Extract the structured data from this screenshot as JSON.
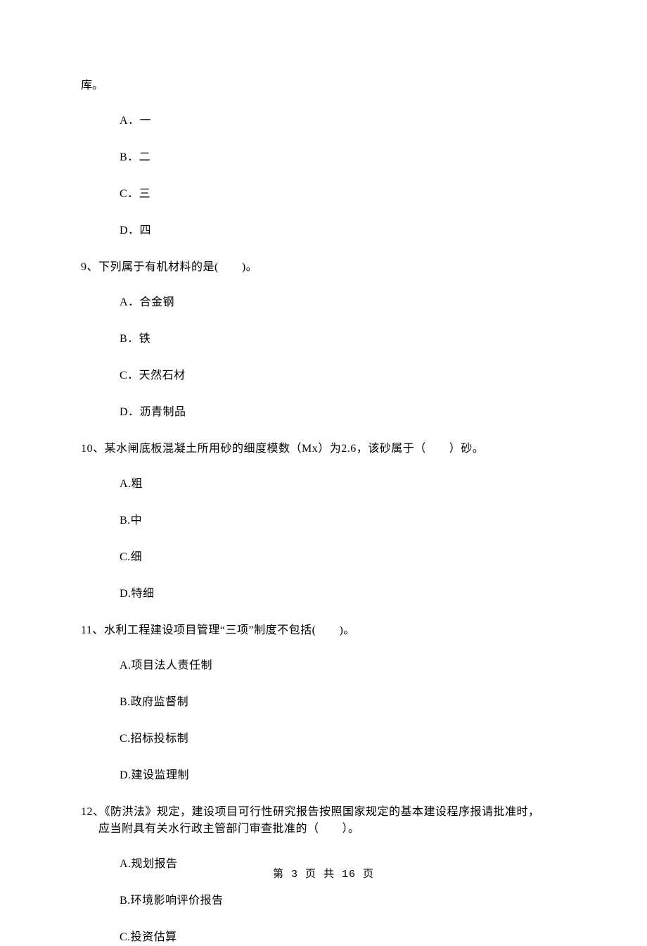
{
  "fragment": "库。",
  "q8_options": {
    "A": "A．一",
    "B": "B．二",
    "C": "C．三",
    "D": "D．四"
  },
  "q9": {
    "stem": "9、下列属于有机材料的是(　　)。",
    "A": "A．合金钢",
    "B": "B．铁",
    "C": "C．天然石材",
    "D": "D．沥青制品"
  },
  "q10": {
    "stem": "10、某水闸底板混凝土所用砂的细度模数（Mx）为2.6，该砂属于（　　）砂。",
    "A": "A.粗",
    "B": "B.中",
    "C": "C.细",
    "D": "D.特细"
  },
  "q11": {
    "stem": "11、水利工程建设项目管理“三项”制度不包括(　　)。",
    "A": "A.项目法人责任制",
    "B": "B.政府监督制",
    "C": "C.招标投标制",
    "D": "D.建设监理制"
  },
  "q12": {
    "stem_line1": "12、《防洪法》规定，建设项目可行性研究报告按照国家规定的基本建设程序报请批准时，",
    "stem_line2": "应当附具有关水行政主管部门审查批准的（　　）。",
    "A": "A.规划报告",
    "B": "B.环境影响评价报告",
    "C": "C.投资估算"
  },
  "footer": "第 3 页 共 16 页"
}
